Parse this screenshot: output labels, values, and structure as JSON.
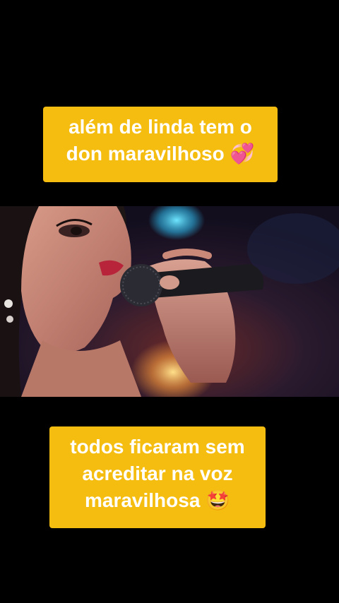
{
  "captions": {
    "top": {
      "line1": "além de linda tem o",
      "line2": "don maravilhoso 💞"
    },
    "bottom": {
      "line1": "todos ficaram sem",
      "line2": "acreditar na voz",
      "line3": "maravilhosa 🤩"
    }
  },
  "colors": {
    "caption_bg": "#f5bd0f",
    "caption_text": "#ffffff",
    "background": "#000000"
  }
}
